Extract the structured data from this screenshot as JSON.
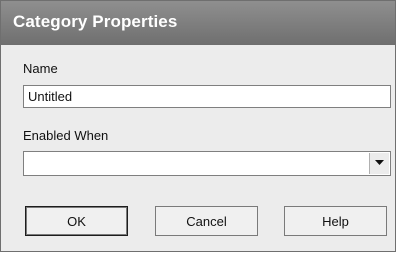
{
  "window": {
    "title": "Category Properties"
  },
  "form": {
    "name_label": "Name",
    "name_value": "Untitled",
    "enabled_label": "Enabled When",
    "enabled_value": ""
  },
  "buttons": {
    "ok": "OK",
    "cancel": "Cancel",
    "help": "Help"
  },
  "icons": {
    "dropdown": "chevron-down-icon"
  }
}
